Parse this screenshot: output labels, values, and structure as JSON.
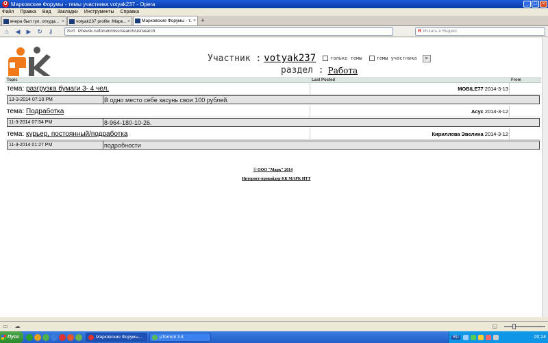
{
  "window": {
    "title": "Марковские Форумы - темы участника votyak237 - Opera",
    "app_icon": "opera-icon"
  },
  "menu": [
    "Файл",
    "Правка",
    "Вид",
    "Закладки",
    "Инструменты",
    "Справка"
  ],
  "tabs": [
    {
      "label": "вчера был гул, откуда...",
      "active": false
    },
    {
      "label": "votyak237 profile :Марк...",
      "active": false
    },
    {
      "label": "Марковские Форумы - т...",
      "active": true
    }
  ],
  "addressbar": {
    "web_label": "Веб",
    "url": "izhevsk.ru/forummisc/search/usrsearch",
    "search_placeholder": "Искать в Яндекс"
  },
  "page": {
    "header": {
      "participant_label": "Участник :",
      "username": "votyak237",
      "only_topics_label": "только темы",
      "user_topics_label": "темы участника",
      "go_button": ">",
      "section_label": "раздел :",
      "section_name": "Работа"
    },
    "columns": {
      "topic": "Topic",
      "last_posted": "Last Posted",
      "from": "From"
    },
    "topic_prefix": "тема:",
    "topics": [
      {
        "title": "разгрузка бумаги 3- 4 чел.",
        "author": "MOBILE77",
        "date": "2014-3-13",
        "msg_date": "13-3-2014 07:10 PM",
        "msg_text": "В одно место себе засунь свои 100 рублей."
      },
      {
        "title": "Подработка",
        "author": "Асус",
        "date": "2014-3-12",
        "msg_date": "11-3-2014 07:54 PM",
        "msg_text": "8-964-180-10-26."
      },
      {
        "title": "курьер, постоянный/подработка",
        "author": "Кириллова Эвелина",
        "date": "2014-3-12",
        "msg_date": "11-3-2014 01:27 PM",
        "msg_text": "подробности"
      }
    ],
    "footer": {
      "copyright": "© ООО \"Марк\" 2014",
      "credit": "Интернет-провайдер КК МАРК ИТТ"
    }
  },
  "taskbar": {
    "start_label": "Пуск",
    "tasks": [
      {
        "label": "Марковские Форумы...",
        "active": true
      },
      {
        "label": "µTorrent 3.4",
        "active": false
      }
    ],
    "lang": "RU",
    "clock": "20:24"
  }
}
